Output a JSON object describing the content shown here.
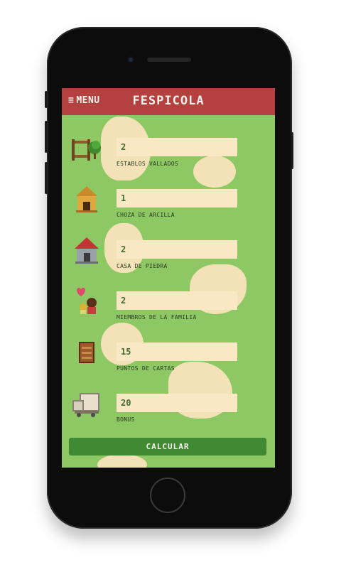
{
  "header": {
    "menu_label": "MENU",
    "title": "FESPICOLA"
  },
  "fields": [
    {
      "value": "2",
      "label": "ESTABLOS VALLADOS",
      "icon": "fenced-stable-icon"
    },
    {
      "value": "1",
      "label": "CHOZA DE ARCILLA",
      "icon": "clay-hut-icon"
    },
    {
      "value": "2",
      "label": "CASA DE PIEDRA",
      "icon": "stone-house-icon"
    },
    {
      "value": "2",
      "label": "MIEMBROS DE LA FAMILIA",
      "icon": "family-members-icon"
    },
    {
      "value": "15",
      "label": "PUNTOS DE CARTAS",
      "icon": "card-points-icon"
    },
    {
      "value": "20",
      "label": "BONUS",
      "icon": "bonus-icon"
    }
  ],
  "button": {
    "label": "CALCULAR"
  },
  "colors": {
    "header": "#b54040",
    "background": "#8ec864",
    "input": "#fae8c4",
    "button": "#3f8a32"
  }
}
